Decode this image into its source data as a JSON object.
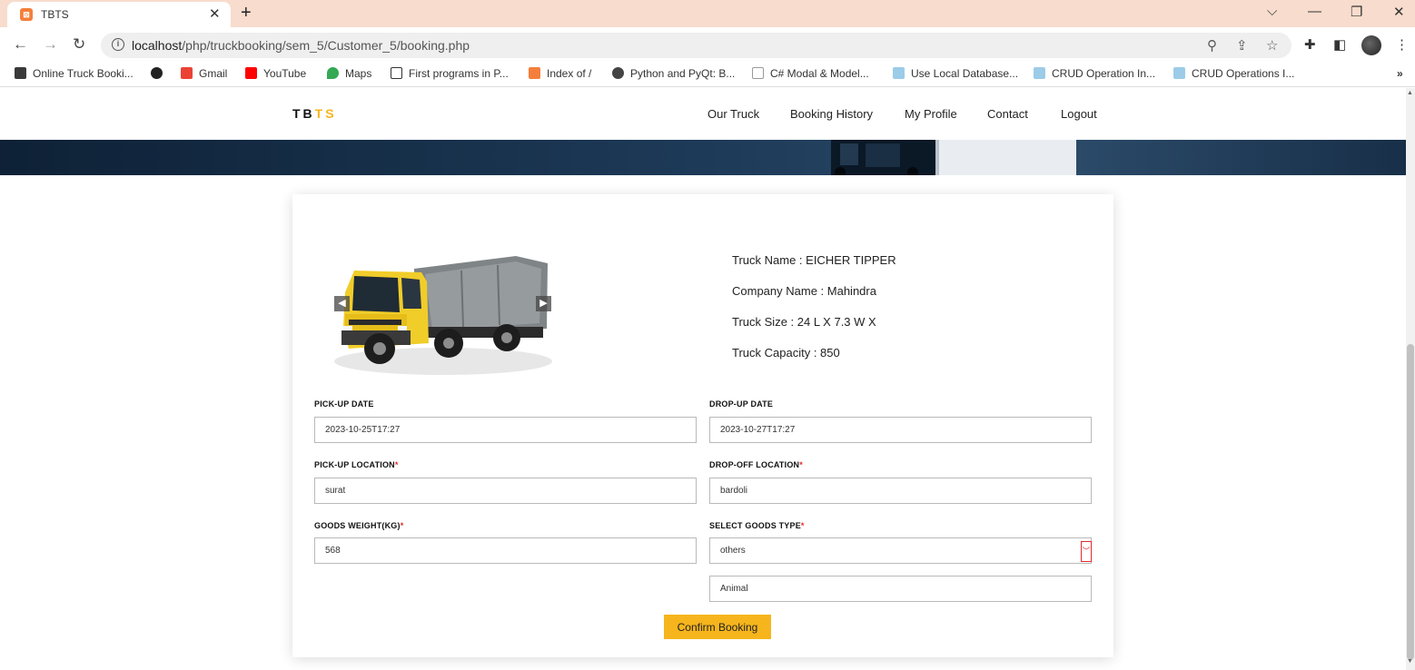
{
  "browser": {
    "tab_title": "TBTS",
    "url_host": "localhost",
    "url_path": "/php/truckbooking/sem_5/Customer_5/booking.php",
    "bookmarks": [
      "Online Truck Booki...",
      "Gmail",
      "YouTube",
      "Maps",
      "First programs in P...",
      "Index of /",
      "Python and PyQt: B...",
      "C# Modal & Model...",
      "Use Local Database...",
      "CRUD Operation In...",
      "CRUD Operations I..."
    ],
    "bookmark_more": "»"
  },
  "site": {
    "logo_a": "TB",
    "logo_b": "TS",
    "nav": [
      "Our Truck",
      "Booking History",
      "My Profile",
      "Contact",
      "Logout"
    ]
  },
  "truck": {
    "name_line": "Truck Name : EICHER TIPPER",
    "company_line": "Company Name : Mahindra",
    "size_line": "Truck Size : 24 L X 7.3 W X",
    "capacity_line": "Truck Capacity : 850"
  },
  "form": {
    "pickup_date_label": "PICK-UP DATE",
    "pickup_date_value": "2023-10-25T17:27",
    "drop_date_label": "DROP-UP DATE",
    "drop_date_value": "2023-10-27T17:27",
    "pickup_location_label": "PICK-UP LOCATION",
    "pickup_location_value": "surat",
    "drop_location_label": "DROP-OFF LOCATION",
    "drop_location_value": "bardoli",
    "weight_label": "GOODS WEIGHT(KG)",
    "weight_value": "568",
    "goods_type_label": "SELECT GOODS TYPE",
    "goods_type_value": "others",
    "other_goods_value": "Animal",
    "required_mark": "*",
    "confirm_label": "Confirm Booking"
  },
  "colors": {
    "accent": "#f6b51c",
    "required": "#e32b2b",
    "tabstrip": "#f8dccd"
  }
}
